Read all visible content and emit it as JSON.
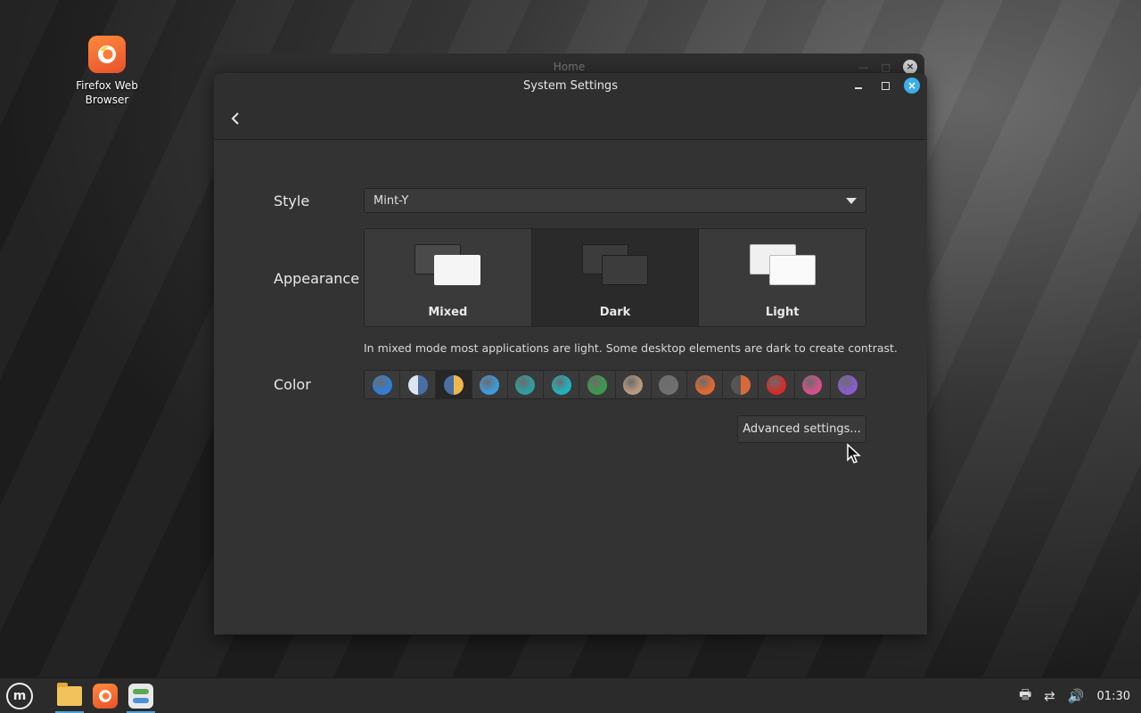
{
  "desktop": {
    "icons": [
      {
        "label": "Firefox Web Browser",
        "icon": "firefox-icon"
      }
    ]
  },
  "background_window": {
    "title": "Home"
  },
  "window": {
    "title": "System Settings",
    "controls": {
      "minimize": "minimize",
      "maximize": "maximize",
      "close": "×"
    }
  },
  "settings": {
    "style": {
      "label": "Style",
      "value": "Mint-Y"
    },
    "appearance": {
      "label": "Appearance",
      "modes": [
        {
          "label": "Mixed",
          "selected": false
        },
        {
          "label": "Dark",
          "selected": true
        },
        {
          "label": "Light",
          "selected": false
        }
      ],
      "hint": "In mixed mode most applications are light. Some desktop elements are dark to create contrast."
    },
    "color": {
      "label": "Color",
      "swatches": [
        {
          "name": "blue",
          "color": "#2f7fd8"
        },
        {
          "name": "aqua-split",
          "color": "#4a6fa5"
        },
        {
          "name": "default-split",
          "color": "#f0b74a",
          "selected": true
        },
        {
          "name": "sky",
          "color": "#3d9be0"
        },
        {
          "name": "teal",
          "color": "#2c9fa3"
        },
        {
          "name": "cyan",
          "color": "#1fb3c0"
        },
        {
          "name": "green",
          "color": "#3a9a4a"
        },
        {
          "name": "sand",
          "color": "#b99a7e"
        },
        {
          "name": "grey",
          "color": "#707070"
        },
        {
          "name": "orange",
          "color": "#e5682f"
        },
        {
          "name": "orange-split",
          "color": "#d86a3a"
        },
        {
          "name": "red",
          "color": "#d52b2b"
        },
        {
          "name": "pink",
          "color": "#d6508a"
        },
        {
          "name": "purple",
          "color": "#8a5bd0"
        }
      ]
    },
    "advanced_button": "Advanced settings..."
  },
  "taskbar": {
    "items": [
      "menu-icon",
      "files-icon",
      "firefox-icon",
      "settings-icon"
    ],
    "clock": "01:30",
    "tray": [
      "printer-icon",
      "network-icon",
      "volume-icon"
    ]
  }
}
